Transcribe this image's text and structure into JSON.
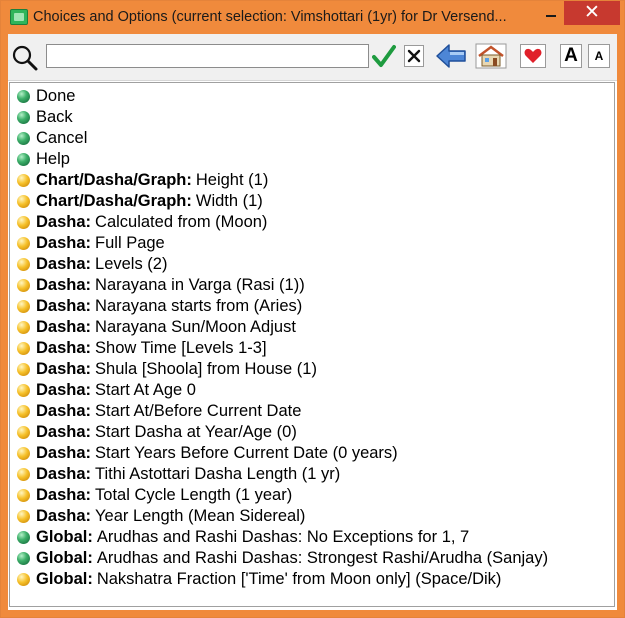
{
  "window": {
    "title": "Choices and Options (current selection: Vimshottari (1yr) for Dr Versend...",
    "minimize_label": "",
    "close_label": "✕"
  },
  "toolbar": {
    "search": {
      "value": "",
      "placeholder": ""
    },
    "buttons": [
      {
        "name": "ok",
        "icon": "checkmark-icon"
      },
      {
        "name": "clear",
        "icon": "x-icon"
      },
      {
        "name": "back",
        "icon": "back-arrow-icon"
      },
      {
        "name": "home",
        "icon": "home-icon"
      },
      {
        "name": "favorite",
        "icon": "heart-icon"
      }
    ],
    "font_larger_label": "A",
    "font_smaller_label": "A"
  },
  "colors": {
    "titlebar": "#f08a3c",
    "close": "#c7392f",
    "bullet_green": "#3db06a",
    "bullet_yellow": "#f6c12a"
  },
  "items": [
    {
      "bullet": "green",
      "prefix": "",
      "text": "Done"
    },
    {
      "bullet": "green",
      "prefix": "",
      "text": "Back"
    },
    {
      "bullet": "green",
      "prefix": "",
      "text": "Cancel"
    },
    {
      "bullet": "green",
      "prefix": "",
      "text": "Help"
    },
    {
      "bullet": "yellow",
      "prefix": "Chart/Dasha/Graph:",
      "text": "Height (1)"
    },
    {
      "bullet": "yellow",
      "prefix": "Chart/Dasha/Graph:",
      "text": "Width (1)"
    },
    {
      "bullet": "yellow",
      "prefix": "Dasha:",
      "text": "Calculated from (Moon)"
    },
    {
      "bullet": "yellow",
      "prefix": "Dasha:",
      "text": "Full Page"
    },
    {
      "bullet": "yellow",
      "prefix": "Dasha:",
      "text": "Levels (2)"
    },
    {
      "bullet": "yellow",
      "prefix": "Dasha:",
      "text": "Narayana in Varga (Rasi (1))"
    },
    {
      "bullet": "yellow",
      "prefix": "Dasha:",
      "text": "Narayana starts from (Aries)"
    },
    {
      "bullet": "yellow",
      "prefix": "Dasha:",
      "text": "Narayana Sun/Moon Adjust"
    },
    {
      "bullet": "yellow",
      "prefix": "Dasha:",
      "text": "Show Time [Levels 1-3]"
    },
    {
      "bullet": "yellow",
      "prefix": "Dasha:",
      "text": "Shula [Shoola] from House (1)"
    },
    {
      "bullet": "yellow",
      "prefix": "Dasha:",
      "text": "Start At Age 0"
    },
    {
      "bullet": "yellow",
      "prefix": "Dasha:",
      "text": "Start At/Before Current Date"
    },
    {
      "bullet": "yellow",
      "prefix": "Dasha:",
      "text": "Start Dasha at Year/Age (0)"
    },
    {
      "bullet": "yellow",
      "prefix": "Dasha:",
      "text": "Start Years Before Current Date (0 years)"
    },
    {
      "bullet": "yellow",
      "prefix": "Dasha:",
      "text": "Tithi Astottari Dasha Length (1 yr)"
    },
    {
      "bullet": "yellow",
      "prefix": "Dasha:",
      "text": "Total Cycle Length (1 year)"
    },
    {
      "bullet": "yellow",
      "prefix": "Dasha:",
      "text": "Year Length (Mean Sidereal)"
    },
    {
      "bullet": "green",
      "prefix": "Global:",
      "text": "Arudhas and Rashi Dashas: No Exceptions for 1, 7"
    },
    {
      "bullet": "green",
      "prefix": "Global:",
      "text": "Arudhas and Rashi Dashas: Strongest Rashi/Arudha (Sanjay)"
    },
    {
      "bullet": "yellow",
      "prefix": "Global:",
      "text": "Nakshatra Fraction ['Time' from Moon only] (Space/Dik)"
    }
  ]
}
